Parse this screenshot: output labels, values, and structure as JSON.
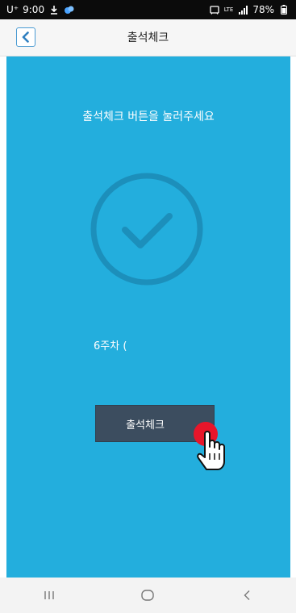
{
  "status_bar": {
    "carrier": "U⁺",
    "time": "9:00",
    "battery": "78%",
    "network": "LTE"
  },
  "header": {
    "title": "출석체크",
    "back_icon": "chevron-left-icon"
  },
  "main": {
    "instruction": "출석체크 버튼을 눌러주세요",
    "week_label": "6주차 (",
    "checkin_button_label": "출석체크",
    "check_icon": "check-circle-icon"
  },
  "nav": {
    "recents_icon": "recents-icon",
    "home_icon": "home-icon",
    "back_icon": "back-icon"
  },
  "colors": {
    "main_background": "#23aedd",
    "button_background": "#3c4d5f",
    "circle_stroke": "#1c8fbb",
    "tap_dot": "#e8162a",
    "accent": "#4b9bd2"
  }
}
